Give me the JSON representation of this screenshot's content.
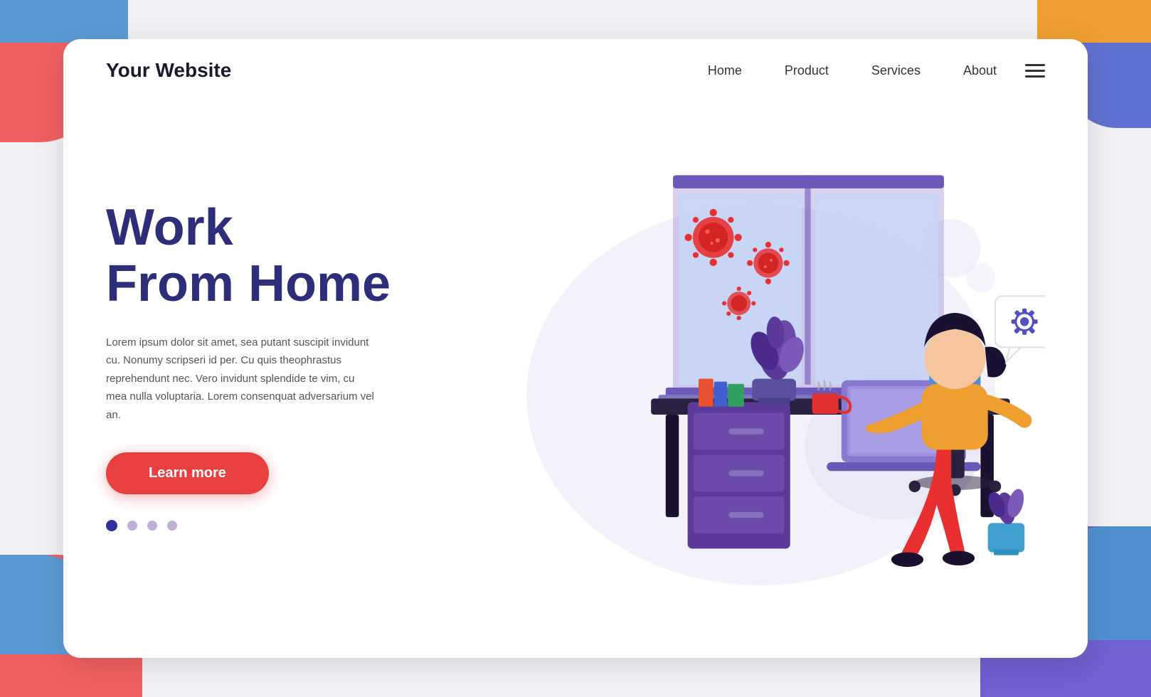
{
  "header": {
    "logo": "Your Website",
    "nav": {
      "home": "Home",
      "product": "Product",
      "services": "Services",
      "about": "About"
    }
  },
  "hero": {
    "title_line1": "Work",
    "title_line2": "From Home",
    "description": "Lorem ipsum dolor sit amet, sea putant suscipit invidunt cu. Nonumy scripseri id per. Cu quis theophrastus reprehendunt nec. Vero invidunt splendide te vim, cu mea nulla voluptaria. Lorem consenquat adversarium vel an.",
    "cta_label": "Learn more"
  },
  "dots": [
    {
      "active": true
    },
    {
      "active": false
    },
    {
      "active": false
    },
    {
      "active": false
    }
  ]
}
